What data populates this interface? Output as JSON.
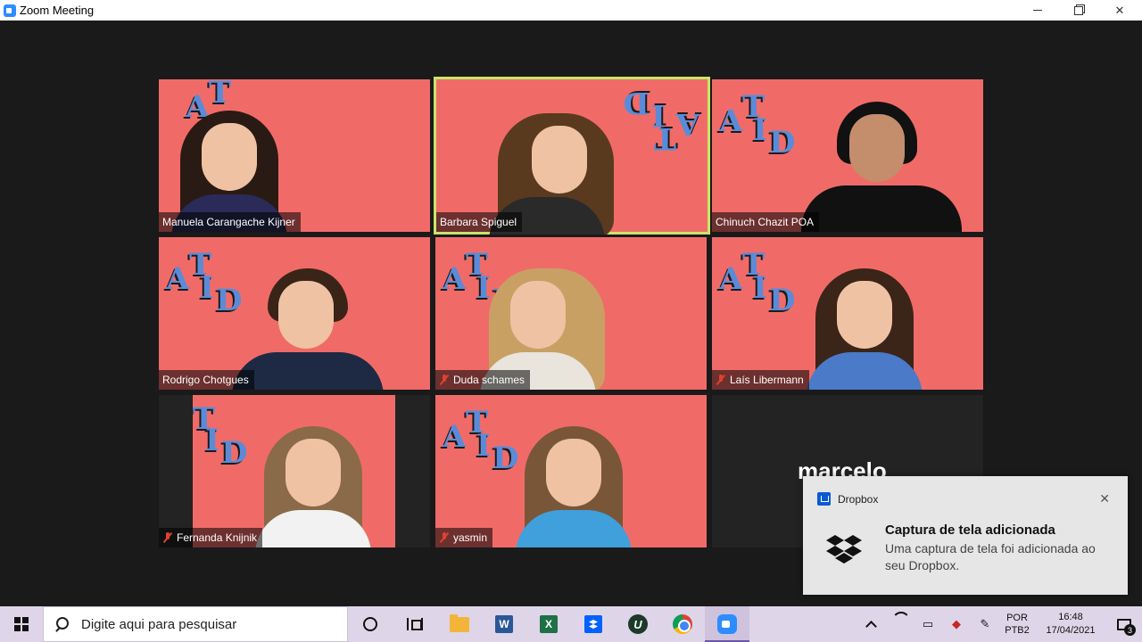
{
  "window": {
    "title": "Zoom Meeting"
  },
  "colors": {
    "tile_bg": "#f06b68",
    "active_border": "#c8e66a",
    "logo": "#5b8bd8"
  },
  "logo": {
    "letters": [
      "A",
      "T",
      "I",
      "D"
    ]
  },
  "participants": [
    {
      "name": "Manuela Carangache Kijner",
      "muted": false,
      "active": false
    },
    {
      "name": "Barbara Spiguel",
      "muted": false,
      "active": true
    },
    {
      "name": "Chinuch Chazit POA",
      "muted": false,
      "active": false
    },
    {
      "name": "Rodrigo Chotgues",
      "muted": false,
      "active": false
    },
    {
      "name": "Duda schames",
      "muted": true,
      "active": false
    },
    {
      "name": "Laís Libermann",
      "muted": true,
      "active": false
    },
    {
      "name": "Fernanda Knijnik",
      "muted": true,
      "active": false
    },
    {
      "name": "yasmin",
      "muted": true,
      "active": false
    },
    {
      "name": "marcelo",
      "muted": false,
      "active": false,
      "video_off": true
    }
  ],
  "notification": {
    "app": "Dropbox",
    "title": "Captura de tela adicionada",
    "body": "Uma captura de tela foi adicionada ao seu Dropbox."
  },
  "taskbar": {
    "search_placeholder": "Digite aqui para pesquisar",
    "pinned": [
      "cortana-icon",
      "task-view-icon",
      "file-explorer-icon",
      "word-icon",
      "excel-icon",
      "dropbox-icon",
      "upwork-icon",
      "chrome-icon",
      "zoom-icon"
    ],
    "word_letter": "W",
    "excel_letter": "X",
    "upwork_letter": "U"
  },
  "tray": {
    "lang_primary": "POR",
    "lang_secondary": "PTB2",
    "time": "16:48",
    "date": "17/04/2021",
    "notification_count": "3"
  }
}
